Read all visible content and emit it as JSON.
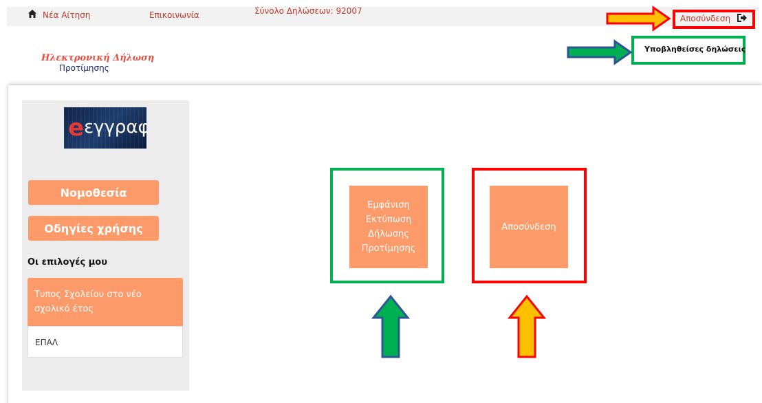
{
  "nav": {
    "home_label": "Νέα Αίτηση",
    "contact_label": "Επικοινωνία",
    "count_text": "Σύνολο Δηλώσεων: 92007",
    "logout_label": "Αποσύνδεση",
    "home_icon": "home-icon",
    "logout_icon": "sign-out-icon"
  },
  "logo": {
    "line1": "Ηλεκτρονική Δήλωση",
    "line2": "Προτίμησης"
  },
  "header": {
    "submitted_link": "Υποβληθείσες δηλώσεις"
  },
  "sidebar": {
    "logo_text": "εγγραφές",
    "buttons": [
      {
        "label": "Νομοθεσία"
      },
      {
        "label": "Οδηγίες χρήσης"
      }
    ],
    "my_choices_heading": "Οι επιλογές μου",
    "choice": {
      "title": "Τυπος Σχολείου στο νέο σχολικό έτος",
      "value": "ΕΠΑΛ"
    }
  },
  "main": {
    "view_print_button": "Εμφάνιση Εκτύπωση Δήλωσης Προτίμησης",
    "logout_button": "Αποσύνδεση"
  },
  "colors": {
    "accent": "#fc9a6a",
    "link": "#c0392b",
    "annotation_green": "#00b050",
    "annotation_red": "#ff0000",
    "annotation_yellow": "#ffc000",
    "annotation_blue": "#2f5597"
  }
}
